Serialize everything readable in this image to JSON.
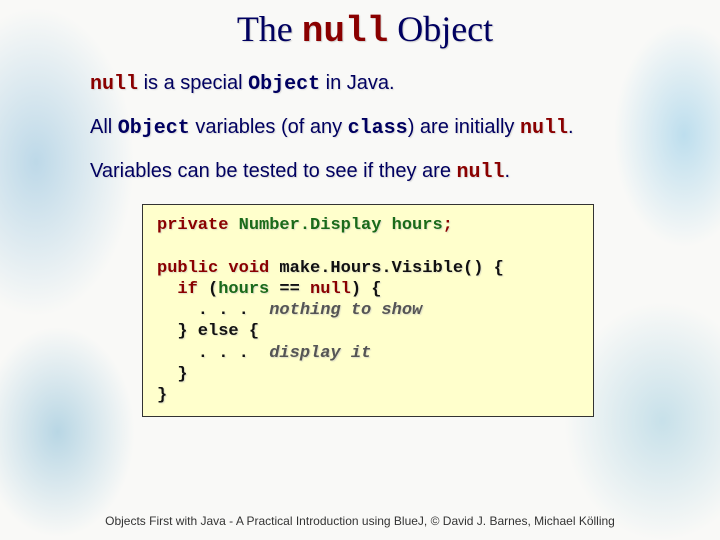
{
  "title": {
    "pre": "The ",
    "kw": "null",
    "post": " Object"
  },
  "lines": {
    "l1": {
      "a": "null",
      "b": " is a special ",
      "c": "Object",
      "d": " in Java."
    },
    "l2": {
      "a": "All ",
      "b": "Object",
      "c": " variables (of any ",
      "d": "class",
      "e": ") are initially ",
      "f": "null",
      "g": "."
    },
    "l3": {
      "a": "Variables can be tested to see if they are ",
      "b": "null",
      "c": "."
    }
  },
  "code": {
    "r1": {
      "kw": "private ",
      "type": "Number.Display ",
      "var": "hours",
      "semi": ";"
    },
    "r2": "",
    "r3": {
      "a": "public void",
      "b": " make.Hours.Visible() {"
    },
    "r4": {
      "a": "  ",
      "b": "if",
      "c": " (",
      "d": "hours",
      "e": " == ",
      "f": "null",
      "g": ") {"
    },
    "r5": {
      "a": "    . . .  ",
      "cmt": "nothing to show"
    },
    "r6": "  } else {",
    "r7": {
      "a": "    . . .  ",
      "cmt": "display it"
    },
    "r8": "  }",
    "r9": "}"
  },
  "footer": "Objects First with Java - A Practical Introduction using BlueJ, © David J. Barnes, Michael Kölling"
}
